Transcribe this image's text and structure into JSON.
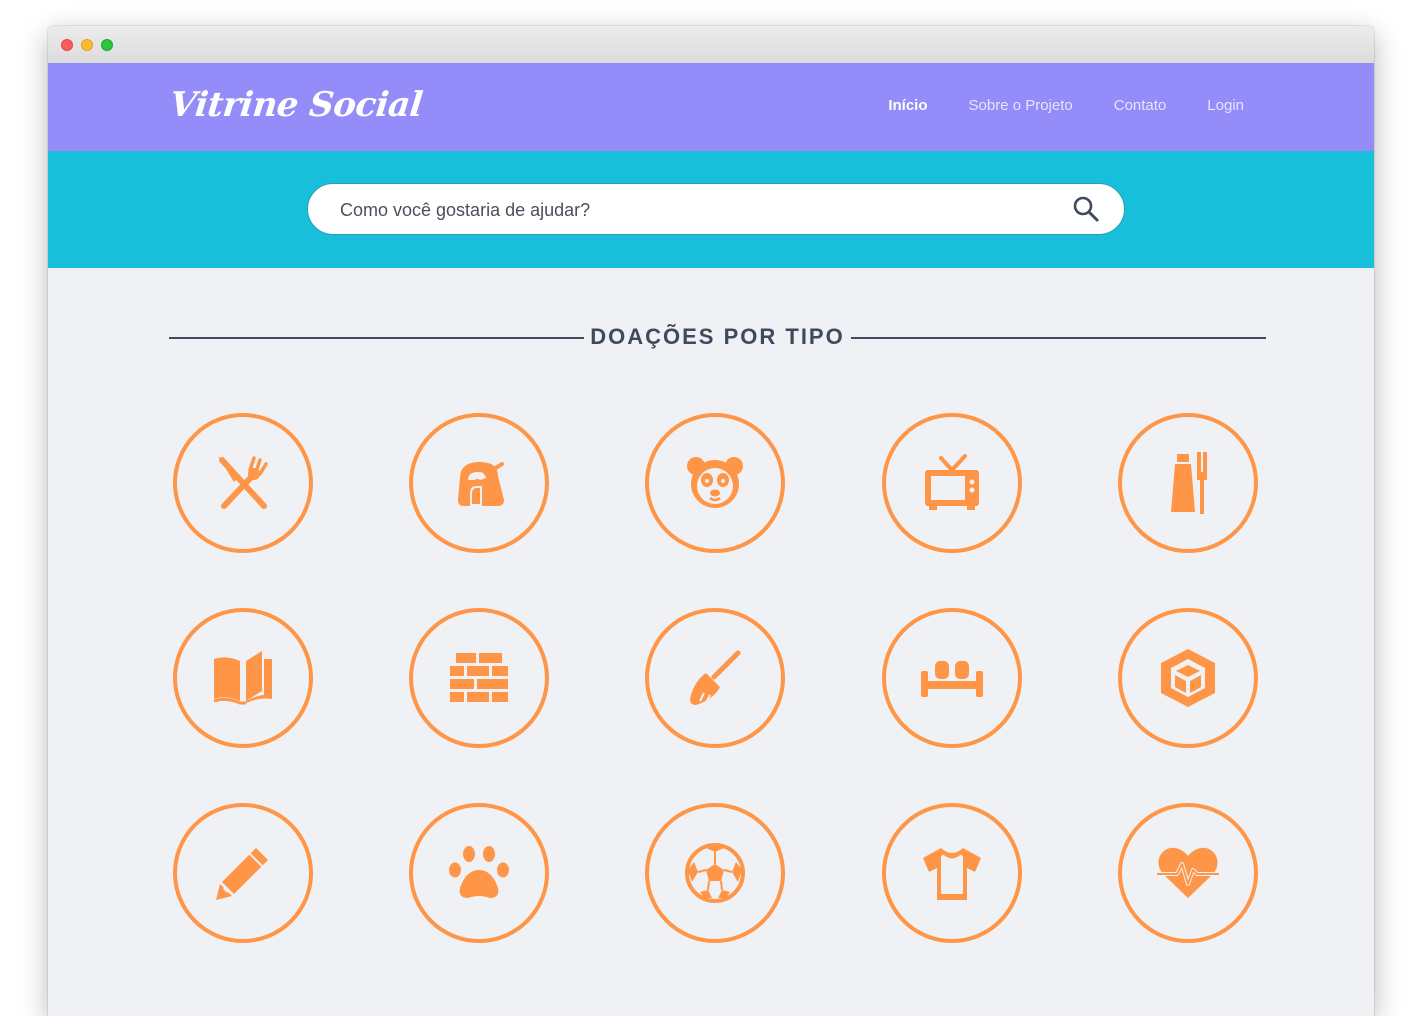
{
  "brand": {
    "name": "Vitrine Social"
  },
  "nav": {
    "items": [
      {
        "label": "Início",
        "active": true
      },
      {
        "label": "Sobre o Projeto",
        "active": false
      },
      {
        "label": "Contato",
        "active": false
      },
      {
        "label": "Login",
        "active": false
      }
    ]
  },
  "search": {
    "placeholder": "Como você gostaria de ajudar?",
    "icon": "search-icon"
  },
  "section": {
    "title": "DOAÇÕES POR TIPO"
  },
  "categories": [
    {
      "icon": "utensils-icon"
    },
    {
      "icon": "toaster-icon"
    },
    {
      "icon": "panda-icon"
    },
    {
      "icon": "tv-icon"
    },
    {
      "icon": "toothpaste-icon"
    },
    {
      "icon": "book-icon"
    },
    {
      "icon": "bricks-icon"
    },
    {
      "icon": "broom-icon"
    },
    {
      "icon": "sofa-icon"
    },
    {
      "icon": "box-icon"
    },
    {
      "icon": "pencil-icon"
    },
    {
      "icon": "paw-icon"
    },
    {
      "icon": "soccer-ball-icon"
    },
    {
      "icon": "tshirt-icon"
    },
    {
      "icon": "heartbeat-icon"
    }
  ],
  "colors": {
    "navbar": "#938cf9",
    "search_band": "#17bfdb",
    "accent": "#ff9547",
    "background": "#f0f1f4",
    "heading": "#3f4a5d"
  }
}
